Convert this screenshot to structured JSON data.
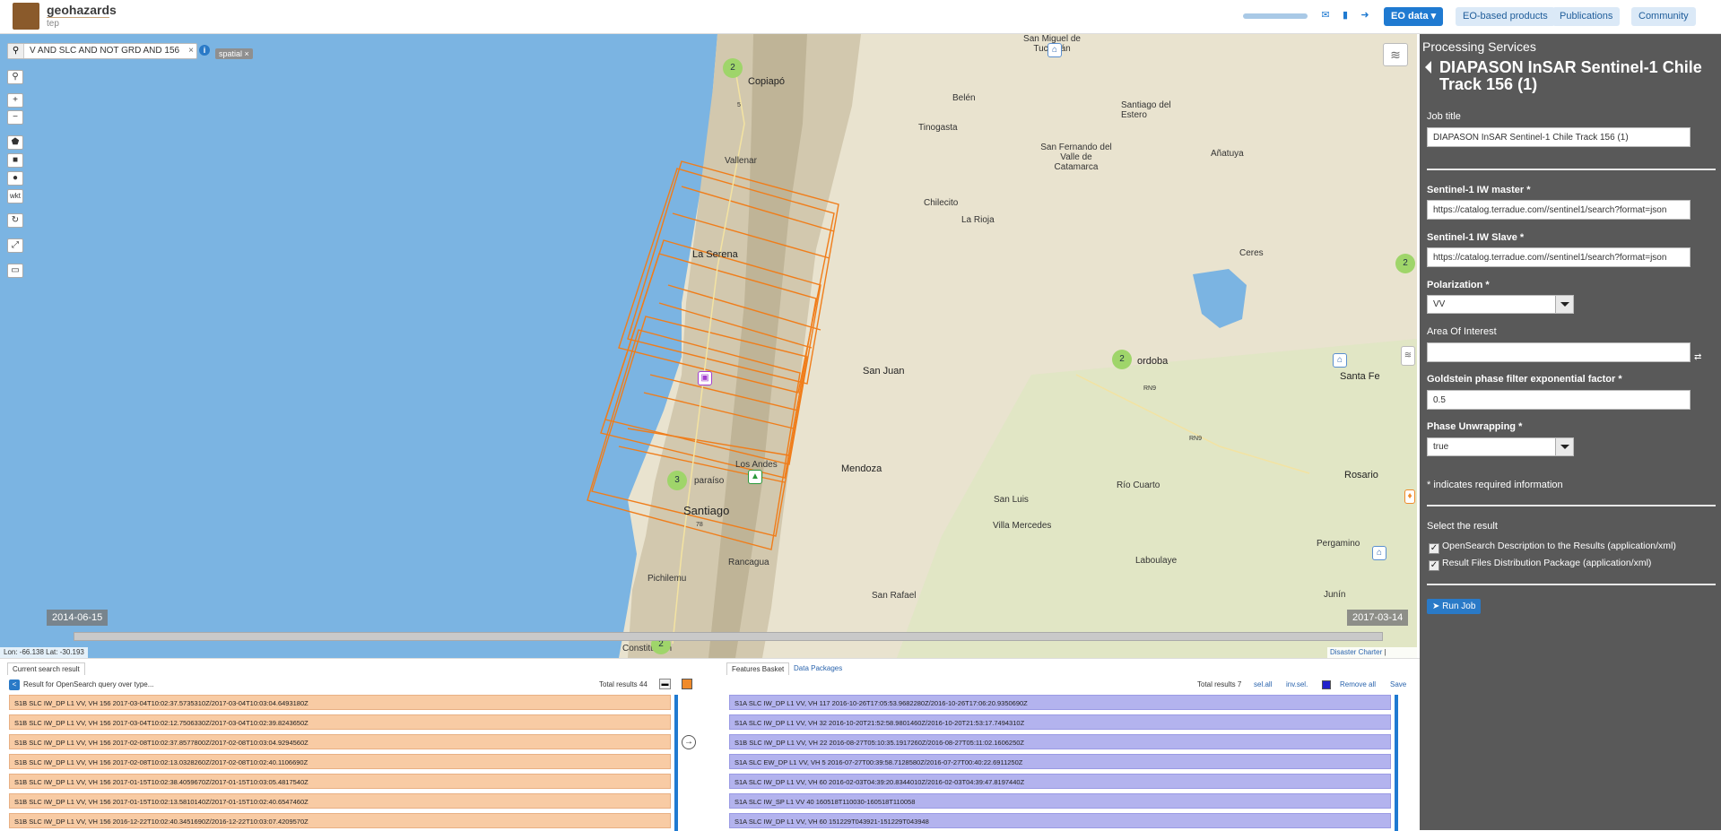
{
  "header": {
    "logo_title": "geohazards",
    "logo_sub": "tep",
    "eo_data": "EO data ▾",
    "eo_products": "EO-based products",
    "publications": "Publications",
    "community": "Community"
  },
  "map": {
    "search_query": "V AND SLC AND NOT GRD AND 156",
    "spatial_tag": "spatial ×",
    "ctrl_wkt": "wkt",
    "start_date": "2014-06-15",
    "end_date": "2017-03-14",
    "lonlat": "Lon: -66.138 Lat: -30.193",
    "attrib_link": "Disaster Charter",
    "attrib_sep": "| Terradue",
    "clusters": [
      "2",
      "2",
      "2",
      "3",
      "2"
    ],
    "labels": {
      "copiapo": "Copiapó",
      "vallenar": "Vallenar",
      "la_serena": "La Serena",
      "los_andes": "Los Andes",
      "valparaiso": "paraíso",
      "santiago": "Santiago",
      "rancagua": "Rancagua",
      "pichilemu": "Pichilemu",
      "constitucion": "Constitución",
      "san_miguel": "San Miguel de Tucumán",
      "belen": "Belén",
      "tinogasta": "Tinogasta",
      "santiago_estero": "Santiago del Estero",
      "catamarca": "San Fernando del Valle de Catamarca",
      "anatuya": "Añatuya",
      "chilecito": "Chilecito",
      "la_rioja": "La Rioja",
      "ceres": "Ceres",
      "san_juan": "San Juan",
      "cordoba": "ordoba",
      "santa_fe": "Santa Fe",
      "mendoza": "Mendoza",
      "san_luis": "San Luis",
      "rio_cuarto": "Río Cuarto",
      "rosario": "Rosario",
      "villa_mercedes": "Villa Mercedes",
      "pergamino": "Pergamino",
      "laboulaye": "Laboulaye",
      "junin": "Junín",
      "san_rafael": "San Rafael",
      "rn9a": "RN9",
      "rn9b": "RN9",
      "r5": "5",
      "r78": "78"
    }
  },
  "panel": {
    "title": "Processing Services",
    "job_heading": "DIAPASON InSAR Sentinel-1 Chile Track 156 (1)",
    "job_title_label": "Job title",
    "job_title_value": "DIAPASON InSAR Sentinel-1 Chile Track 156 (1)",
    "master_label": "Sentinel-1 IW master *",
    "master_value": "https://catalog.terradue.com//sentinel1/search?format=json",
    "slave_label": "Sentinel-1 IW Slave *",
    "slave_value": "https://catalog.terradue.com//sentinel1/search?format=json",
    "pol_label": "Polarization *",
    "pol_value": "VV",
    "aoi_label": "Area Of Interest",
    "aoi_value": "",
    "goldstein_label": "Goldstein phase filter exponential factor *",
    "goldstein_value": "0.5",
    "unwrap_label": "Phase Unwrapping *",
    "unwrap_value": "true",
    "required_note": "* indicates required information",
    "select_result": "Select the result",
    "result1": "OpenSearch Description to the Results (application/xml)",
    "result2": "Result Files Distribution Package (application/xml)",
    "run_job": "Run Job"
  },
  "bottom": {
    "tab_current": "Current search result",
    "tab_basket": "Features Basket",
    "tab_packages": "Data Packages",
    "result_title": "Result for OpenSearch query over type...",
    "total_left": "Total results  44",
    "total_right": "Total results  7",
    "sel_all": "sel.all",
    "inv_sel": "inv.sel.",
    "remove_all": "Remove all",
    "save": "Save",
    "left_rows": [
      "S1B SLC IW_DP L1 VV, VH 156 2017-03-04T10:02:37.5735310Z/2017-03-04T10:03:04.6493180Z",
      "S1B SLC IW_DP L1 VV, VH 156 2017-03-04T10:02:12.7506330Z/2017-03-04T10:02:39.8243650Z",
      "S1B SLC IW_DP L1 VV, VH 156 2017-02-08T10:02:37.8577800Z/2017-02-08T10:03:04.9294560Z",
      "S1B SLC IW_DP L1 VV, VH 156 2017-02-08T10:02:13.0328260Z/2017-02-08T10:02:40.1106690Z",
      "S1B SLC IW_DP L1 VV, VH 156 2017-01-15T10:02:38.4059670Z/2017-01-15T10:03:05.4817540Z",
      "S1B SLC IW_DP L1 VV, VH 156 2017-01-15T10:02:13.5810140Z/2017-01-15T10:02:40.6547460Z",
      "S1B SLC IW_DP L1 VV, VH 156 2016-12-22T10:02:40.3451690Z/2016-12-22T10:03:07.4209570Z"
    ],
    "right_rows": [
      "S1A SLC IW_DP L1 VV, VH 117 2016-10-26T17:05:53.9682280Z/2016-10-26T17:06:20.9350690Z",
      "S1A SLC IW_DP L1 VV, VH 32 2016-10-20T21:52:58.9801460Z/2016-10-20T21:53:17.7494310Z",
      "S1B SLC IW_DP L1 VV, VH 22 2016-08-27T05:10:35.1917260Z/2016-08-27T05:11:02.1606250Z",
      "S1A SLC EW_DP L1 VV, VH 5 2016-07-27T00:39:58.7128580Z/2016-07-27T00:40:22.6911250Z",
      "S1A SLC IW_DP L1 VV, VH 60 2016-02-03T04:39:20.8344010Z/2016-02-03T04:39:47.8197440Z",
      "S1A SLC IW_SP L1 VV 40 160518T110030-160518T110058",
      "S1A SLC IW_DP L1 VV, VH 60 151229T043921-151229T043948"
    ]
  }
}
